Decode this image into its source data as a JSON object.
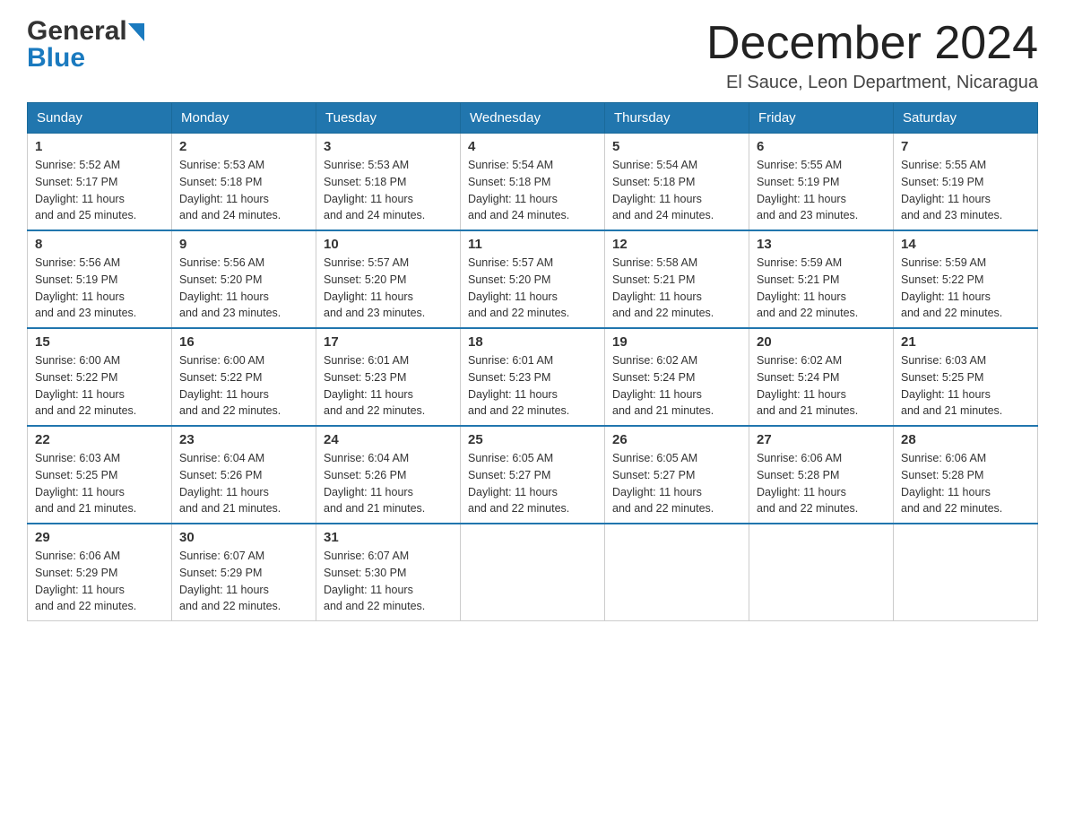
{
  "header": {
    "logo_general": "General",
    "logo_blue": "Blue",
    "month_title": "December 2024",
    "location": "El Sauce, Leon Department, Nicaragua"
  },
  "days_of_week": [
    "Sunday",
    "Monday",
    "Tuesday",
    "Wednesday",
    "Thursday",
    "Friday",
    "Saturday"
  ],
  "weeks": [
    [
      {
        "day": "1",
        "sunrise": "5:52 AM",
        "sunset": "5:17 PM",
        "daylight": "11 hours and 25 minutes."
      },
      {
        "day": "2",
        "sunrise": "5:53 AM",
        "sunset": "5:18 PM",
        "daylight": "11 hours and 24 minutes."
      },
      {
        "day": "3",
        "sunrise": "5:53 AM",
        "sunset": "5:18 PM",
        "daylight": "11 hours and 24 minutes."
      },
      {
        "day": "4",
        "sunrise": "5:54 AM",
        "sunset": "5:18 PM",
        "daylight": "11 hours and 24 minutes."
      },
      {
        "day": "5",
        "sunrise": "5:54 AM",
        "sunset": "5:18 PM",
        "daylight": "11 hours and 24 minutes."
      },
      {
        "day": "6",
        "sunrise": "5:55 AM",
        "sunset": "5:19 PM",
        "daylight": "11 hours and 23 minutes."
      },
      {
        "day": "7",
        "sunrise": "5:55 AM",
        "sunset": "5:19 PM",
        "daylight": "11 hours and 23 minutes."
      }
    ],
    [
      {
        "day": "8",
        "sunrise": "5:56 AM",
        "sunset": "5:19 PM",
        "daylight": "11 hours and 23 minutes."
      },
      {
        "day": "9",
        "sunrise": "5:56 AM",
        "sunset": "5:20 PM",
        "daylight": "11 hours and 23 minutes."
      },
      {
        "day": "10",
        "sunrise": "5:57 AM",
        "sunset": "5:20 PM",
        "daylight": "11 hours and 23 minutes."
      },
      {
        "day": "11",
        "sunrise": "5:57 AM",
        "sunset": "5:20 PM",
        "daylight": "11 hours and 22 minutes."
      },
      {
        "day": "12",
        "sunrise": "5:58 AM",
        "sunset": "5:21 PM",
        "daylight": "11 hours and 22 minutes."
      },
      {
        "day": "13",
        "sunrise": "5:59 AM",
        "sunset": "5:21 PM",
        "daylight": "11 hours and 22 minutes."
      },
      {
        "day": "14",
        "sunrise": "5:59 AM",
        "sunset": "5:22 PM",
        "daylight": "11 hours and 22 minutes."
      }
    ],
    [
      {
        "day": "15",
        "sunrise": "6:00 AM",
        "sunset": "5:22 PM",
        "daylight": "11 hours and 22 minutes."
      },
      {
        "day": "16",
        "sunrise": "6:00 AM",
        "sunset": "5:22 PM",
        "daylight": "11 hours and 22 minutes."
      },
      {
        "day": "17",
        "sunrise": "6:01 AM",
        "sunset": "5:23 PM",
        "daylight": "11 hours and 22 minutes."
      },
      {
        "day": "18",
        "sunrise": "6:01 AM",
        "sunset": "5:23 PM",
        "daylight": "11 hours and 22 minutes."
      },
      {
        "day": "19",
        "sunrise": "6:02 AM",
        "sunset": "5:24 PM",
        "daylight": "11 hours and 21 minutes."
      },
      {
        "day": "20",
        "sunrise": "6:02 AM",
        "sunset": "5:24 PM",
        "daylight": "11 hours and 21 minutes."
      },
      {
        "day": "21",
        "sunrise": "6:03 AM",
        "sunset": "5:25 PM",
        "daylight": "11 hours and 21 minutes."
      }
    ],
    [
      {
        "day": "22",
        "sunrise": "6:03 AM",
        "sunset": "5:25 PM",
        "daylight": "11 hours and 21 minutes."
      },
      {
        "day": "23",
        "sunrise": "6:04 AM",
        "sunset": "5:26 PM",
        "daylight": "11 hours and 21 minutes."
      },
      {
        "day": "24",
        "sunrise": "6:04 AM",
        "sunset": "5:26 PM",
        "daylight": "11 hours and 21 minutes."
      },
      {
        "day": "25",
        "sunrise": "6:05 AM",
        "sunset": "5:27 PM",
        "daylight": "11 hours and 22 minutes."
      },
      {
        "day": "26",
        "sunrise": "6:05 AM",
        "sunset": "5:27 PM",
        "daylight": "11 hours and 22 minutes."
      },
      {
        "day": "27",
        "sunrise": "6:06 AM",
        "sunset": "5:28 PM",
        "daylight": "11 hours and 22 minutes."
      },
      {
        "day": "28",
        "sunrise": "6:06 AM",
        "sunset": "5:28 PM",
        "daylight": "11 hours and 22 minutes."
      }
    ],
    [
      {
        "day": "29",
        "sunrise": "6:06 AM",
        "sunset": "5:29 PM",
        "daylight": "11 hours and 22 minutes."
      },
      {
        "day": "30",
        "sunrise": "6:07 AM",
        "sunset": "5:29 PM",
        "daylight": "11 hours and 22 minutes."
      },
      {
        "day": "31",
        "sunrise": "6:07 AM",
        "sunset": "5:30 PM",
        "daylight": "11 hours and 22 minutes."
      },
      null,
      null,
      null,
      null
    ]
  ],
  "labels": {
    "sunrise": "Sunrise:",
    "sunset": "Sunset:",
    "daylight": "Daylight:"
  }
}
